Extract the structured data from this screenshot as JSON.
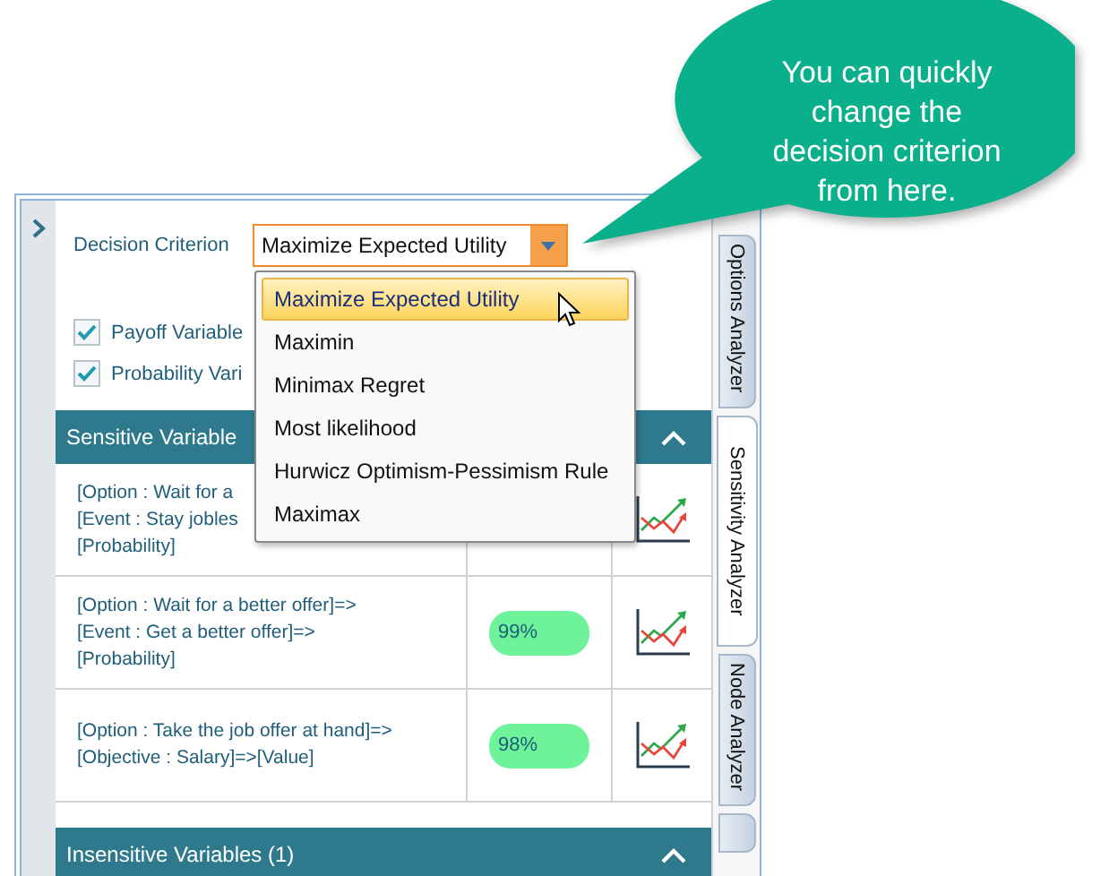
{
  "criterion": {
    "label": "Decision Criterion",
    "value": "Maximize Expected Utility"
  },
  "dropdown": {
    "options": [
      {
        "label": "Maximize Expected Utility",
        "selected": true
      },
      {
        "label": "Maximin",
        "selected": false
      },
      {
        "label": "Minimax Regret",
        "selected": false
      },
      {
        "label": "Most likelihood",
        "selected": false
      },
      {
        "label": "Hurwicz Optimism-Pessimism Rule",
        "selected": false
      },
      {
        "label": "Maximax",
        "selected": false
      }
    ]
  },
  "checkboxes": [
    {
      "label": "Payoff Variable",
      "checked": true
    },
    {
      "label": "Probability Vari",
      "checked": true
    }
  ],
  "sections": [
    {
      "title": "Sensitive Variable",
      "expanded": true,
      "rows": [
        {
          "lines": [
            "[Option : Wait for a",
            "[Event : Stay jobles",
            "[Probability]"
          ]
        },
        {
          "lines": [
            "[Option : Wait for a better offer]=>",
            "[Event : Get a better offer]=>",
            "[Probability]"
          ],
          "percent": "99%"
        },
        {
          "lines": [
            "[Option : Take the job offer at hand]=>",
            "[Objective : Salary]=>[Value]"
          ],
          "percent": "98%"
        }
      ]
    },
    {
      "title": "Insensitive Variables (1)",
      "expanded": true
    }
  ],
  "tabs": [
    {
      "label": "Options Analyzer",
      "selected": false
    },
    {
      "label": "Sensitivity Analyzer",
      "selected": true
    },
    {
      "label": "Node Analyzer",
      "selected": false
    }
  ],
  "callout": {
    "text": "You can quickly change the decision criterion from here."
  }
}
